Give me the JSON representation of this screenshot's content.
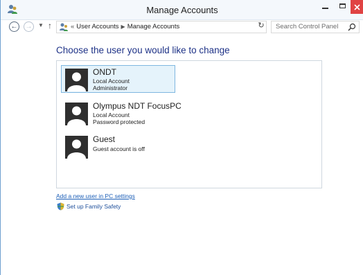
{
  "window": {
    "title": "Manage Accounts",
    "icons": {
      "app": "users-control-panel-icon",
      "minimize": "minimize-icon",
      "maximize": "maximize-icon",
      "close": "close-icon"
    }
  },
  "address_bar": {
    "back_icon": "back-arrow-icon",
    "forward_icon": "forward-arrow-icon",
    "recent_icon": "chevron-down-icon",
    "up_icon": "up-arrow-icon",
    "overflow": "«",
    "breadcrumbs": [
      "User Accounts",
      "Manage Accounts"
    ],
    "refresh_icon": "refresh-icon"
  },
  "search": {
    "placeholder": "Search Control Panel",
    "icon": "search-icon"
  },
  "main": {
    "heading": "Choose the user you would like to change",
    "accounts": [
      {
        "name": "ONDT",
        "lines": [
          "Local Account",
          "Administrator"
        ],
        "selected": true
      },
      {
        "name": "Olympus NDT FocusPC",
        "lines": [
          "Local Account",
          "Password protected"
        ],
        "selected": false
      },
      {
        "name": "Guest",
        "lines": [
          "Guest account is off"
        ],
        "selected": false
      }
    ],
    "add_user_link": "Add a new user in PC settings",
    "family_safety_link": "Set up Family Safety",
    "family_safety_icon": "family-safety-shield-icon"
  },
  "colors": {
    "heading": "#1e3287",
    "link": "#1d5fb7",
    "selection_bg": "#e5f3fb",
    "selection_border": "#7fb7e0",
    "close_button": "#e04343"
  }
}
